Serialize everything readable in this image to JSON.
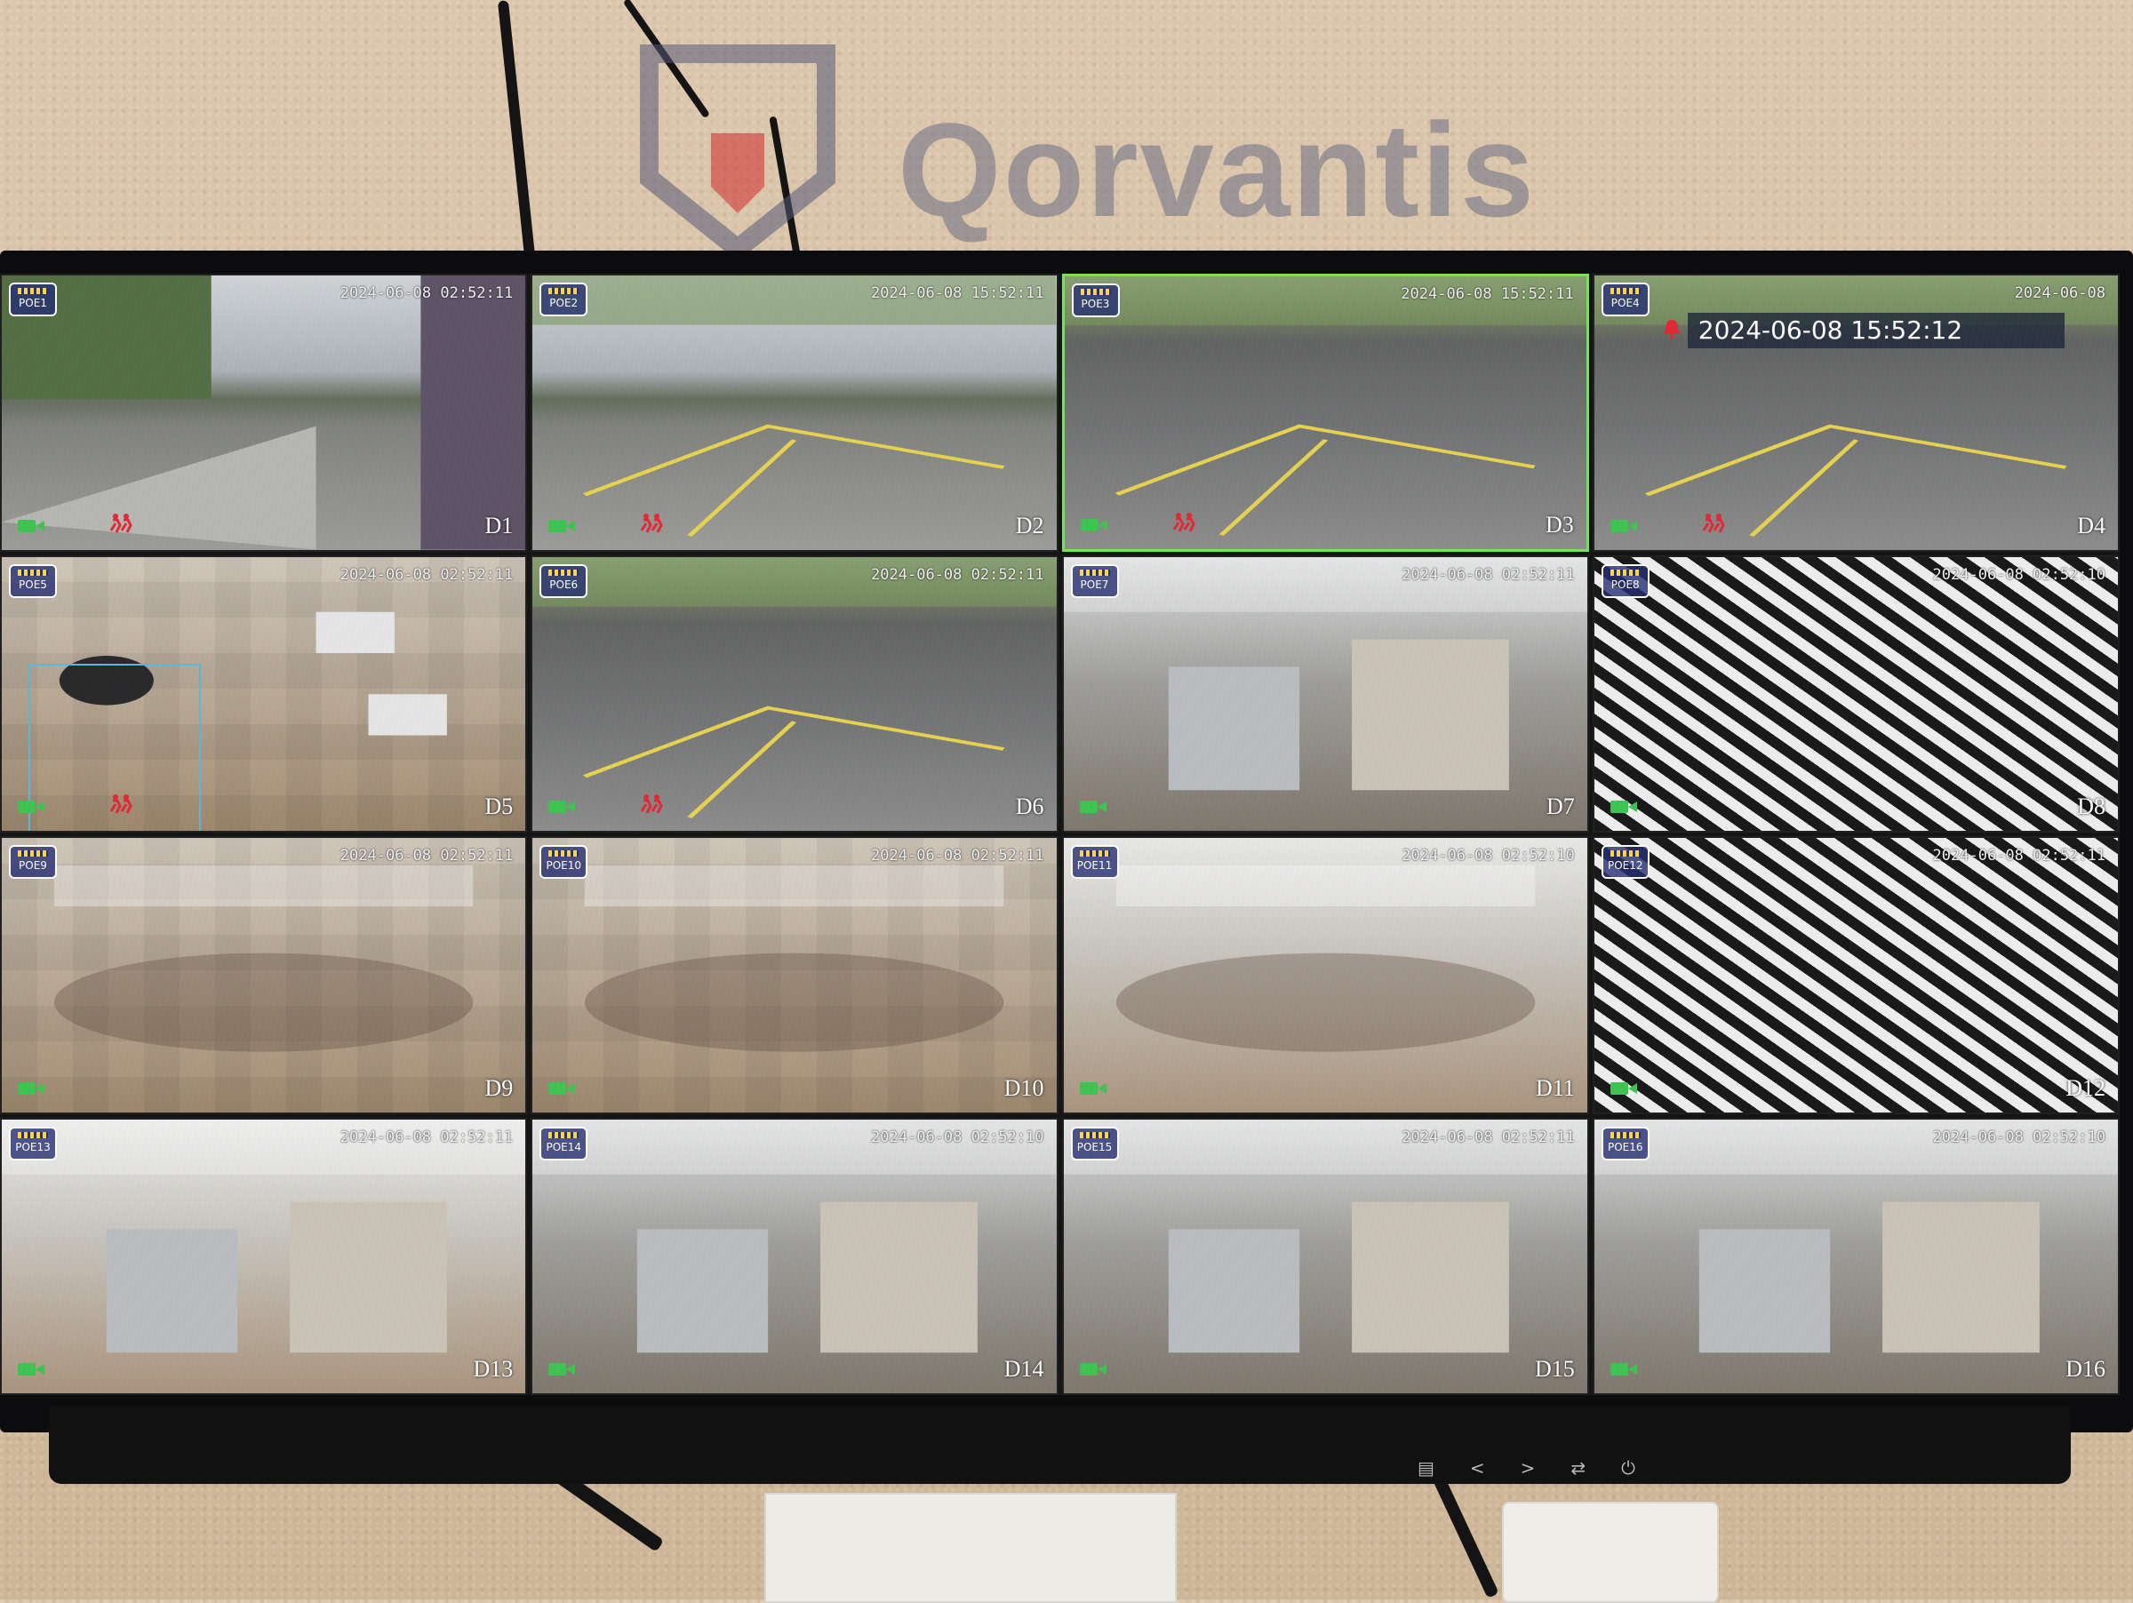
{
  "watermark": {
    "text": "Qorvantis"
  },
  "tiles": [
    {
      "channel": "D1",
      "timestamp": "2024-06-08 02:52:11",
      "poe": "POE1",
      "scene": "alley"
    },
    {
      "channel": "D2",
      "timestamp": "2024-06-08 15:52:11",
      "poe": "POE2",
      "scene": "drive"
    },
    {
      "channel": "D3",
      "timestamp": "2024-06-08 15:52:11",
      "poe": "POE3",
      "scene": "lot",
      "selected": true
    },
    {
      "channel": "D4",
      "timestamp": "2024-06-08",
      "poe": "POE4",
      "scene": "lot2",
      "overlay_timestamp": "2024-06-08 15:52:12"
    },
    {
      "channel": "D5",
      "timestamp": "2024-06-08 02:52:11",
      "poe": "POE5",
      "scene": "overhead"
    },
    {
      "channel": "D6",
      "timestamp": "2024-06-08 02:52:11",
      "poe": "POE6",
      "scene": "curb"
    },
    {
      "channel": "D7",
      "timestamp": "2024-06-08 02:52:11",
      "poe": "POE7",
      "scene": "backroom"
    },
    {
      "channel": "D8",
      "timestamp": "2024-06-08 02:52:10",
      "poe": "POE8",
      "scene": "hall"
    },
    {
      "channel": "D9",
      "timestamp": "2024-06-08 02:52:11",
      "poe": "POE9",
      "scene": "dining"
    },
    {
      "channel": "D10",
      "timestamp": "2024-06-08 02:52:11",
      "poe": "POE10",
      "scene": "dining2"
    },
    {
      "channel": "D11",
      "timestamp": "2024-06-08 02:52:10",
      "poe": "POE11",
      "scene": "counter"
    },
    {
      "channel": "D12",
      "timestamp": "2024-06-08 02:52:11",
      "poe": "POE12",
      "scene": "zebra"
    },
    {
      "channel": "D13",
      "timestamp": "2024-06-08 02:52:11",
      "poe": "POE13",
      "scene": "storage"
    },
    {
      "channel": "D14",
      "timestamp": "2024-06-08 02:52:10",
      "poe": "POE14",
      "scene": "kitchen"
    },
    {
      "channel": "D15",
      "timestamp": "2024-06-08 02:52:11",
      "poe": "POE15",
      "scene": "kitchen2"
    },
    {
      "channel": "D16",
      "timestamp": "2024-06-08 02:52:10",
      "poe": "POE16",
      "scene": "kitchen3"
    }
  ],
  "icons": {
    "recording": "camera-recording-icon",
    "motion": "motion-alert-icon",
    "alarm": "alarm-bell-icon"
  },
  "colors": {
    "selected_border": "#78e05a",
    "rec_icon": "#38c34b",
    "motion_icon": "#e0232d",
    "person_box": "#54b7d6"
  },
  "monitor_buttons": [
    "menu",
    "left",
    "right",
    "input",
    "power"
  ]
}
